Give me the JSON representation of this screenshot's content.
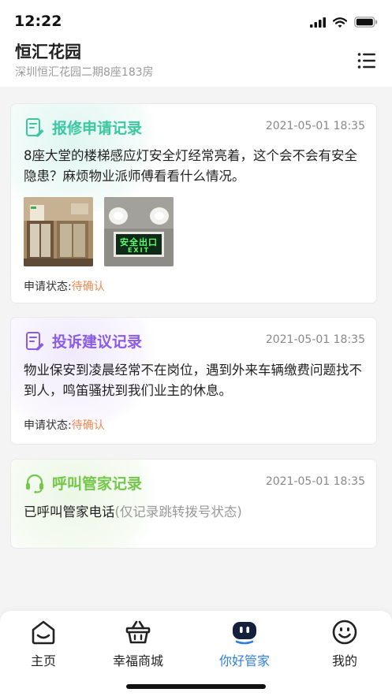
{
  "status_bar": {
    "time": "12:22"
  },
  "header": {
    "title": "恒汇花园",
    "subtitle": "深圳恒汇花园二期8座183房"
  },
  "cards": [
    {
      "title": "报修申请记录",
      "time": "2021-05-01 18:35",
      "text": "8座大堂的楼梯感应灯安全灯经常亮着，这个会不会有安全隐患？麻烦物业派师傅看看什么情况。",
      "status_label": "申请状态:",
      "status_value": "待确认",
      "sign_text": "安全出口",
      "sign_sub": "EXIT"
    },
    {
      "title": "投诉建议记录",
      "time": "2021-05-01 18:35",
      "text": "物业保安到凌晨经常不在岗位，遇到外来车辆缴费问题找不到人，鸣笛骚扰到我们业主的休息。",
      "status_label": "申请状态:",
      "status_value": "待确认"
    },
    {
      "title": "呼叫管家记录",
      "time": "2021-05-01 18:35",
      "text_main": "已呼叫管家电话",
      "text_note": "(仅记录跳转拨号状态)"
    }
  ],
  "tabs": [
    {
      "label": "主页",
      "icon": "home-icon"
    },
    {
      "label": "幸福商城",
      "icon": "basket-icon"
    },
    {
      "label": "你好管家",
      "icon": "robot-icon"
    },
    {
      "label": "我的",
      "icon": "smiley-icon"
    }
  ],
  "colors": {
    "repair_accent": "#3cc7a3",
    "complaint_accent": "#8b5be6",
    "call_accent": "#74c74b",
    "status_pending": "#f08a52",
    "tab_active": "#2f7de1"
  }
}
